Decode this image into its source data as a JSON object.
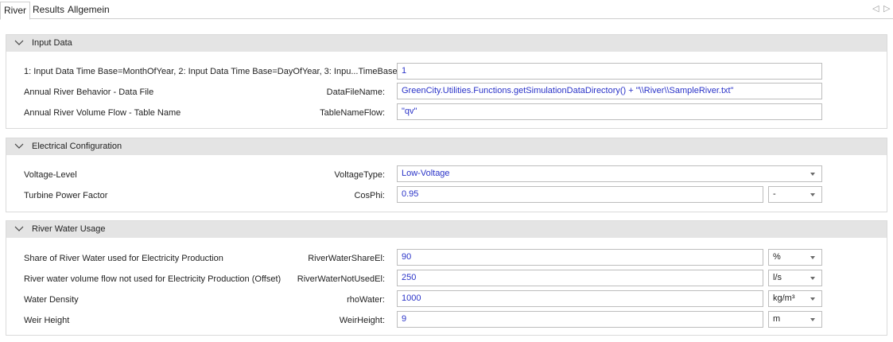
{
  "tabs": [
    {
      "label": "River"
    },
    {
      "label": "Results"
    },
    {
      "label": "Allgemein"
    }
  ],
  "tab_nav": {
    "prev": "◁",
    "next": "▷"
  },
  "groups": {
    "input": {
      "title": "Input Data",
      "rows": [
        {
          "label": "1: Input Data Time Base=MonthOfYear, 2: Input Data Time Base=DayOfYear, 3: Inpu...TimeBase:",
          "param": "",
          "value": "1"
        },
        {
          "label": "Annual River Behavior - Data File",
          "param": "DataFileName:",
          "value": "GreenCity.Utilities.Functions.getSimulationDataDirectory() + \"\\\\River\\\\SampleRiver.txt\""
        },
        {
          "label": "Annual River Volume Flow - Table Name",
          "param": "TableNameFlow:",
          "value": "\"qv\""
        }
      ]
    },
    "electrical": {
      "title": "Electrical Configuration",
      "rows": [
        {
          "label": "Voltage-Level",
          "param": "VoltageType:",
          "value": "Low-Voltage"
        },
        {
          "label": "Turbine Power Factor",
          "param": "CosPhi:",
          "value": "0.95",
          "unit": "-"
        }
      ]
    },
    "water": {
      "title": "River Water Usage",
      "rows": [
        {
          "label": "Share of River Water used for Electricity Production",
          "param": "RiverWaterShareEl:",
          "value": "90",
          "unit": "%"
        },
        {
          "label": "River water volume flow not used for Electricity Production (Offset)",
          "param": "RiverWaterNotUsedEl:",
          "value": "250",
          "unit": "l/s"
        },
        {
          "label": "Water Density",
          "param": "rhoWater:",
          "value": "1000",
          "unit": "kg/m³"
        },
        {
          "label": "Weir Height",
          "param": "WeirHeight:",
          "value": "9",
          "unit": "m"
        }
      ]
    }
  }
}
